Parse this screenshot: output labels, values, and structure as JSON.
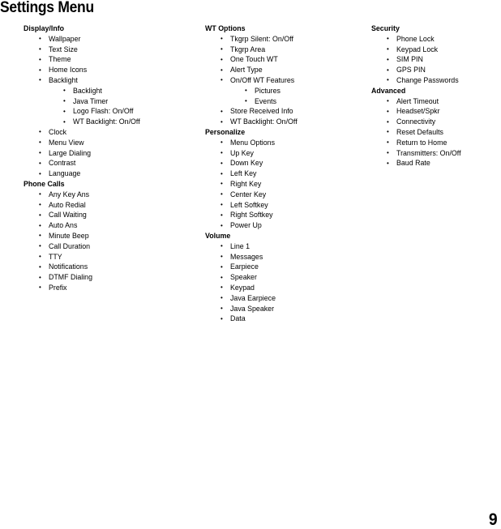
{
  "document": {
    "title": "Settings Menu",
    "page_number": "9",
    "text_color": "#000000",
    "background_color": "#ffffff"
  },
  "columns": [
    {
      "id": "column-1",
      "sections": [
        {
          "heading": "Display/Info",
          "items": [
            {
              "label": "Wallpaper",
              "children": []
            },
            {
              "label": "Text Size",
              "children": []
            },
            {
              "label": "Theme",
              "children": []
            },
            {
              "label": "Home Icons",
              "children": []
            },
            {
              "label": "Backlight",
              "children": [
                {
                  "label": "Backlight"
                },
                {
                  "label": "Java Timer"
                },
                {
                  "label": "Logo Flash: On/Off"
                },
                {
                  "label": "WT Backlight: On/Off"
                }
              ]
            },
            {
              "label": "Clock",
              "children": []
            },
            {
              "label": "Menu View",
              "children": []
            },
            {
              "label": "Large Dialing",
              "children": []
            },
            {
              "label": "Contrast",
              "children": []
            },
            {
              "label": "Language",
              "children": []
            }
          ]
        },
        {
          "heading": "Phone Calls",
          "items": [
            {
              "label": "Any Key Ans",
              "children": []
            },
            {
              "label": "Auto Redial",
              "children": []
            },
            {
              "label": "Call Waiting",
              "children": []
            },
            {
              "label": "Auto Ans",
              "children": []
            },
            {
              "label": "Minute Beep",
              "children": []
            },
            {
              "label": "Call Duration",
              "children": []
            },
            {
              "label": "TTY",
              "children": []
            },
            {
              "label": "Notifications",
              "children": []
            },
            {
              "label": "DTMF Dialing",
              "children": []
            },
            {
              "label": "Prefix",
              "children": []
            }
          ]
        }
      ]
    },
    {
      "id": "column-2",
      "sections": [
        {
          "heading": "WT Options",
          "items": [
            {
              "label": "Tkgrp Silent: On/Off",
              "children": []
            },
            {
              "label": "Tkgrp Area",
              "children": []
            },
            {
              "label": "One Touch WT",
              "children": []
            },
            {
              "label": "Alert Type",
              "children": []
            },
            {
              "label": "On/Off WT Features",
              "children": [
                {
                  "label": "Pictures"
                },
                {
                  "label": "Events"
                }
              ]
            },
            {
              "label": "Store Received Info",
              "children": []
            },
            {
              "label": "WT Backlight: On/Off",
              "children": []
            }
          ]
        },
        {
          "heading": "Personalize",
          "items": [
            {
              "label": "Menu Options",
              "children": []
            },
            {
              "label": "Up Key",
              "children": []
            },
            {
              "label": "Down Key",
              "children": []
            },
            {
              "label": "Left Key",
              "children": []
            },
            {
              "label": "Right Key",
              "children": []
            },
            {
              "label": "Center Key",
              "children": []
            },
            {
              "label": "Left Softkey",
              "children": []
            },
            {
              "label": "Right Softkey",
              "children": []
            },
            {
              "label": "Power Up",
              "children": []
            }
          ]
        },
        {
          "heading": "Volume",
          "items": [
            {
              "label": "Line 1",
              "children": []
            },
            {
              "label": "Messages",
              "children": []
            },
            {
              "label": "Earpiece",
              "children": []
            },
            {
              "label": "Speaker",
              "children": []
            },
            {
              "label": "Keypad",
              "children": []
            },
            {
              "label": "Java Earpiece",
              "children": []
            },
            {
              "label": "Java Speaker",
              "children": []
            },
            {
              "label": "Data",
              "children": []
            }
          ]
        }
      ]
    },
    {
      "id": "column-3",
      "sections": [
        {
          "heading": "Security",
          "items": [
            {
              "label": "Phone Lock",
              "children": []
            },
            {
              "label": "Keypad Lock",
              "children": []
            },
            {
              "label": "SIM PIN",
              "children": []
            },
            {
              "label": "GPS PIN",
              "children": []
            },
            {
              "label": "Change Passwords",
              "children": []
            }
          ]
        },
        {
          "heading": "Advanced",
          "items": [
            {
              "label": "Alert Timeout",
              "children": []
            },
            {
              "label": "Headset/Spkr",
              "children": []
            },
            {
              "label": "Connectivity",
              "children": []
            },
            {
              "label": "Reset Defaults",
              "children": []
            },
            {
              "label": "Return to Home",
              "children": []
            },
            {
              "label": "Transmitters: On/Off",
              "children": []
            },
            {
              "label": "Baud Rate",
              "children": []
            }
          ]
        }
      ]
    }
  ]
}
